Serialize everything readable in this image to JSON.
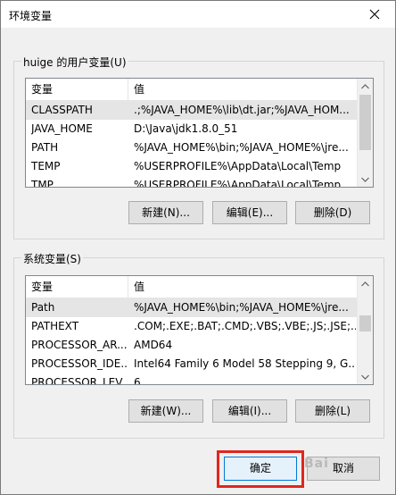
{
  "window": {
    "title": "环境变量",
    "close_icon": "close-icon"
  },
  "user_vars": {
    "group_label": "huige 的用户变量(U)",
    "col_variable": "变量",
    "col_value": "值",
    "rows": [
      {
        "name": "CLASSPATH",
        "value": ".;%JAVA_HOME%\\lib\\dt.jar;%JAVA_HOM..."
      },
      {
        "name": "JAVA_HOME",
        "value": "D:\\Java\\jdk1.8.0_51"
      },
      {
        "name": "PATH",
        "value": "%JAVA_HOME%\\bin;%JAVA_HOME%\\jre..."
      },
      {
        "name": "TEMP",
        "value": "%USERPROFILE%\\AppData\\Local\\Temp"
      },
      {
        "name": "TMP",
        "value": "%USERPROFILE%\\AppData\\Local\\Temp"
      }
    ],
    "new_label": "新建(N)...",
    "edit_label": "编辑(E)...",
    "delete_label": "删除(D)"
  },
  "system_vars": {
    "group_label": "系统变量(S)",
    "col_variable": "变量",
    "col_value": "值",
    "rows": [
      {
        "name": "Path",
        "value": "%JAVA_HOME%\\bin;%JAVA_HOME%\\jre..."
      },
      {
        "name": "PATHEXT",
        "value": ".COM;.EXE;.BAT;.CMD;.VBS;.VBE;.JS;.JSE;...."
      },
      {
        "name": "PROCESSOR_AR...",
        "value": "AMD64"
      },
      {
        "name": "PROCESSOR_IDE...",
        "value": "Intel64 Family 6 Model 58 Stepping 9, G..."
      },
      {
        "name": "PROCESSOR_LEV...",
        "value": "6"
      }
    ],
    "new_label": "新建(W)...",
    "edit_label": "编辑(I)...",
    "delete_label": "删除(L)"
  },
  "footer": {
    "ok_label": "确定",
    "cancel_label": "取消",
    "watermark": "Bai"
  },
  "colors": {
    "highlight_frame": "#e0261f",
    "primary_border": "#0078d7"
  }
}
